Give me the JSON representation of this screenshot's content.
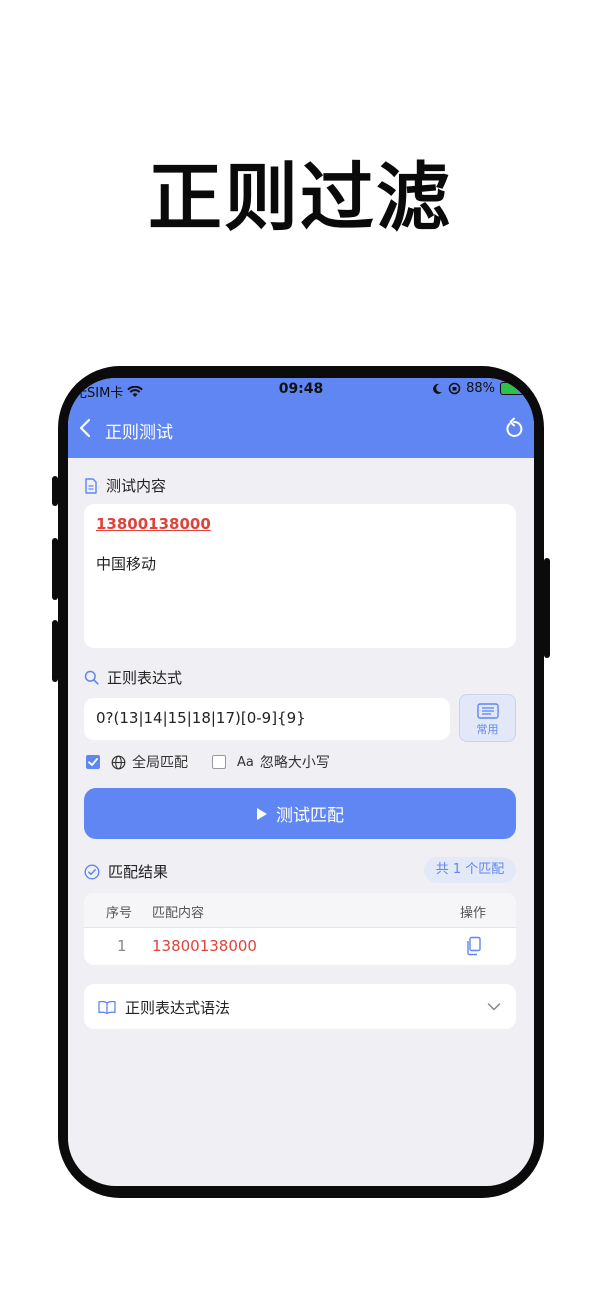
{
  "promo": {
    "title": "正则过滤"
  },
  "status_bar": {
    "carrier": "无SIM卡",
    "time": "09:48",
    "battery": "88%"
  },
  "appbar": {
    "title": "正则测试",
    "back_icon": "chevron-left-icon",
    "reset_icon": "refresh-icon"
  },
  "test_content": {
    "label": "测试内容",
    "lines": [
      "13800138000",
      "中国移动"
    ]
  },
  "regex": {
    "label": "正则表达式",
    "value": "0?(13|14|15|18|17)[0-9]{9}",
    "common_label": "常用"
  },
  "options": {
    "global_label": "全局匹配",
    "global_checked": true,
    "ignore_case_prefix": "Aa",
    "ignore_case_label": "忽略大小写",
    "ignore_case_checked": false
  },
  "run_button": {
    "label": "测试匹配"
  },
  "results": {
    "label": "匹配结果",
    "count_badge": "共 1 个匹配",
    "columns": [
      "序号",
      "匹配内容",
      "操作"
    ],
    "rows": [
      {
        "index": "1",
        "content": "13800138000"
      }
    ]
  },
  "syntax": {
    "label": "正则表达式语法"
  },
  "colors": {
    "accent": "#5f86f2",
    "match": "#e0433a",
    "background": "#f0f0f4"
  }
}
